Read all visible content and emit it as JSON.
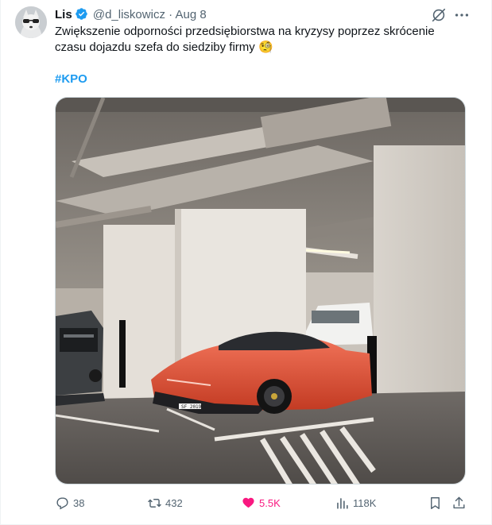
{
  "author": {
    "name": "Lis",
    "handle": "@d_liskowicz",
    "separator": "·",
    "date": "Aug 8"
  },
  "tweet": {
    "text_line1": "Zwiększenie odporności przedsiębiorstwa na kryzysy poprzez skrócenie",
    "text_line2": "czasu dojazdu szefa do siedziby firmy",
    "emoji": "🧐",
    "hashtag": "#KPO"
  },
  "media": {
    "plate_text": "SF 2019"
  },
  "actions": {
    "replies": "38",
    "reposts": "432",
    "likes": "5.5K",
    "views": "118K"
  },
  "colors": {
    "accent": "#1d9bf0",
    "like": "#f91880",
    "muted": "#536471"
  },
  "icons": [
    "verified-badge-icon",
    "grok-icon",
    "more-icon",
    "reply-icon",
    "repost-icon",
    "heart-icon",
    "views-icon",
    "bookmark-icon",
    "share-icon"
  ]
}
